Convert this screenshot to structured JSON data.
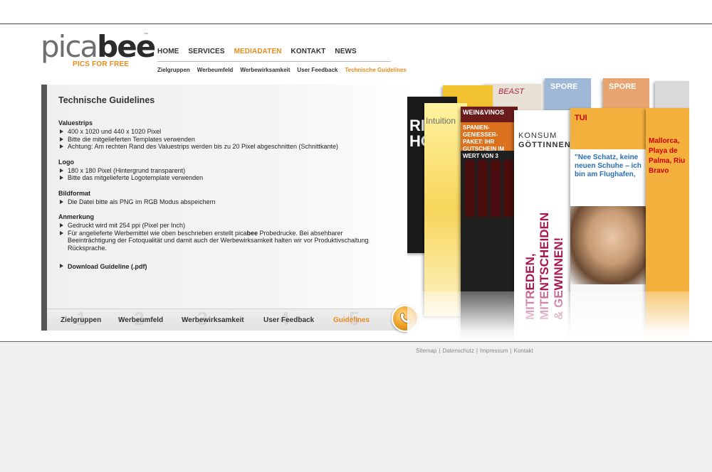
{
  "brand": {
    "logo_part1": "pica",
    "logo_part2": "bee",
    "tm": "™",
    "slogan": "PICS FOR FREE"
  },
  "main_nav": [
    {
      "label": "HOME",
      "active": false
    },
    {
      "label": "SERVICES",
      "active": false
    },
    {
      "label": "MEDIADATEN",
      "active": true
    },
    {
      "label": "KONTAKT",
      "active": false
    },
    {
      "label": "NEWS",
      "active": false
    }
  ],
  "sub_nav": [
    {
      "label": "Zielgruppen",
      "active": false
    },
    {
      "label": "Werbeumfeld",
      "active": false
    },
    {
      "label": "Werbewirksamkeit",
      "active": false
    },
    {
      "label": "User Feedback",
      "active": false
    },
    {
      "label": "Technische Guidelines",
      "active": true
    }
  ],
  "content": {
    "title": "Technische Guidelines",
    "sections": [
      {
        "heading": "Valuestrips",
        "items": [
          "400 x 1020 und 440 x 1020 Pixel",
          "Bitte die mitgelieferten Templates verwenden",
          "Achtung: Am rechten Rand des Valuestrips werden bis zu 20 Pixel abgeschnitten (Schnittkante)"
        ]
      },
      {
        "heading": "Logo",
        "items": [
          "180 x 180 Pixel (Hintergrund transparent)",
          "Bitte das mitgelieferte Logotemplate verwenden"
        ]
      },
      {
        "heading": "Bildformat",
        "items": [
          "Die Datei bitte als PNG im RGB Modus abspeichern"
        ]
      },
      {
        "heading": "Anmerkung",
        "items": [
          "Gedruckt wird mit 254 ppi (Pixel per Inch)"
        ],
        "item2_prefix": "Für angelieferte Werbemittel wie oben beschrieben erstellt pica",
        "item2_bold": "bee",
        "item2_suffix": " Probedrucke. Bei absehbarer Beeinträchtigung der Fotoqualität und damit auch der Werbewirksamkeit halten wir vor Produktivschaltung Rücksprache."
      }
    ],
    "download_label": "Download Guideline (.pdf)"
  },
  "tabs": [
    {
      "label": "Zielgruppen",
      "num": "1",
      "active": false
    },
    {
      "label": "Werbeumfeld",
      "num": "2",
      "active": false
    },
    {
      "label": "Werbewirksamkeit",
      "num": "3",
      "active": false
    },
    {
      "label": "User Feedback",
      "num": "4",
      "active": false
    },
    {
      "label": "Guidelines",
      "num": "5",
      "active": true
    }
  ],
  "collage": {
    "dark_text": "RI\nHO",
    "intuition": "Intuition",
    "wein_title": "WEIN&VINOS",
    "wein_promo": "SPANIEN-GENIESSER-PAKET: IHR GUTSCHEIN IM WERT VON 3",
    "beast": "BEAST",
    "spore1": "SPORE",
    "spore2": "SPORE",
    "konsum_line1": "KONSUM",
    "konsum_line2": "GÖTTINNEN",
    "konsum_vertical": "MITREDEN, MITENTSCHEIDEN & GEWINNEN!",
    "tui_logo": "TUI",
    "tui_text": "\"Nee Schatz, keine neuen Schuhe – ich bin am Flughafen,",
    "tui_side": "Mallorca, Playa de Palma, Riu Bravo"
  },
  "footer": {
    "links": [
      "Sitemap",
      "Datenschutz",
      "Impressum",
      "Kontakt"
    ]
  },
  "colors": {
    "accent": "#e98b1a",
    "text": "#333333",
    "panel_bar": "#555555"
  }
}
